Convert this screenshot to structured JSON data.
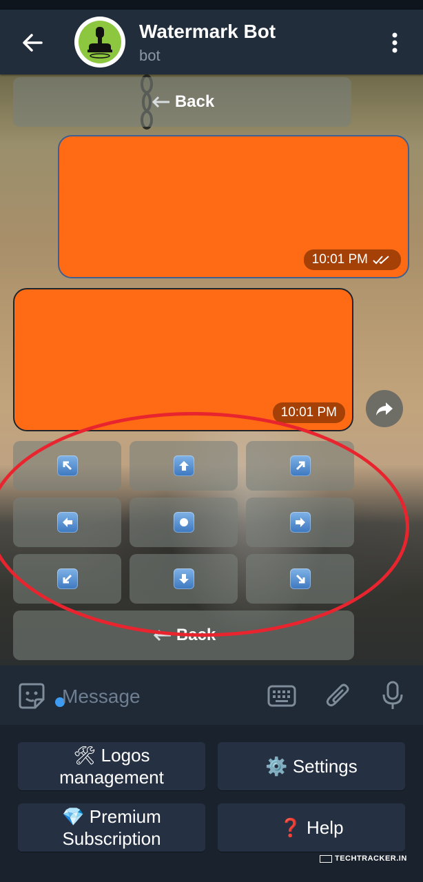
{
  "header": {
    "title": "Watermark Bot",
    "subtitle": "bot"
  },
  "inline_keyboard_top": {
    "back_label": "Back"
  },
  "messages": [
    {
      "direction": "outgoing",
      "color": "#ff6b14",
      "time": "10:01 PM",
      "read_icon": "double-check-icon"
    },
    {
      "direction": "incoming",
      "color": "#ff6b14",
      "time": "10:01 PM"
    }
  ],
  "position_keyboard": {
    "buttons": [
      {
        "name": "top-left",
        "icon": "arrow-up-left-icon",
        "glyph": "↖"
      },
      {
        "name": "top",
        "icon": "arrow-up-icon",
        "glyph": "⬆"
      },
      {
        "name": "top-right",
        "icon": "arrow-up-right-icon",
        "glyph": "↗"
      },
      {
        "name": "left",
        "icon": "arrow-left-icon",
        "glyph": "⬅"
      },
      {
        "name": "center",
        "icon": "circle-icon",
        "glyph": "●"
      },
      {
        "name": "right",
        "icon": "arrow-right-icon",
        "glyph": "➡"
      },
      {
        "name": "bottom-left",
        "icon": "arrow-down-left-icon",
        "glyph": "↙"
      },
      {
        "name": "bottom",
        "icon": "arrow-down-icon",
        "glyph": "⬇"
      },
      {
        "name": "bottom-right",
        "icon": "arrow-down-right-icon",
        "glyph": "↘"
      }
    ],
    "back_label": "Back"
  },
  "input": {
    "placeholder": "Message"
  },
  "reply_keyboard": {
    "logos_label": "🛠 Logos management",
    "settings_label": "⚙️ Settings",
    "premium_label": "💎 Premium Subscription",
    "help_label": "❓ Help"
  },
  "watermark": {
    "text": "TECHTRACKER.IN"
  },
  "colors": {
    "header_bg": "#212d3b",
    "accent_blue": "#3e9bf2",
    "bubble_orange": "#ff6b14",
    "annotation_red": "#e8252f"
  }
}
